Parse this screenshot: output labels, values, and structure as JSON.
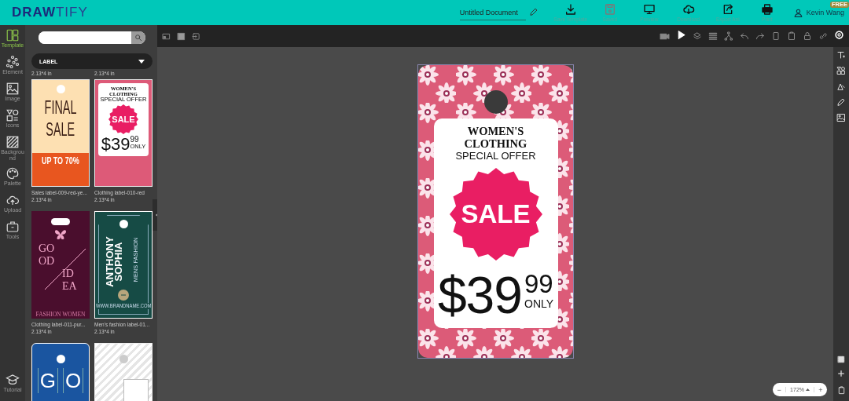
{
  "header": {
    "logo": [
      "DRAW",
      "TIFY"
    ],
    "document_title": "Untitled Document",
    "actions": [
      {
        "label": "Save Template",
        "kind": "download"
      },
      {
        "label": "Saved",
        "kind": "save"
      },
      {
        "label": "Preview",
        "kind": "preview"
      },
      {
        "label": "Download",
        "kind": "cloud"
      },
      {
        "label": "Export Ani",
        "kind": "export"
      },
      {
        "label": "Print",
        "kind": "print"
      }
    ],
    "user": {
      "name": "Kevin Wang",
      "badge": "FREE"
    }
  },
  "sidebar": {
    "items": [
      {
        "label": "Template",
        "kind": "template",
        "selected": true
      },
      {
        "label": "Element",
        "kind": "element",
        "selected": false
      },
      {
        "label": "Image",
        "kind": "image",
        "selected": false
      },
      {
        "label": "Icons",
        "kind": "icons",
        "selected": false
      },
      {
        "label": "Background",
        "kind": "background",
        "selected": false
      },
      {
        "label": "Palette",
        "kind": "palette",
        "selected": false
      },
      {
        "label": "Upload",
        "kind": "upload",
        "selected": false
      },
      {
        "label": "Tools",
        "kind": "tools",
        "selected": false
      }
    ],
    "footer": "Tutorial"
  },
  "template_panel": {
    "category": "LABEL",
    "sizes_above": [
      "2.13*4 in",
      "2.13*4 in"
    ],
    "templates": [
      {
        "kind": "final-sale",
        "name": "Sales label-009-red-ye...",
        "size": "2.13*4 in",
        "texts": [
          "FINAL",
          "SALE",
          "UP TO 70%"
        ]
      },
      {
        "kind": "clothing-sale",
        "name": "Clothing label-010-red",
        "size": "2.13*4 in",
        "texts": [
          "WOMEN'S",
          "CLOTHING",
          "SPECIAL OFFER",
          "SALE",
          "$39",
          "99",
          "ONLY"
        ]
      },
      {
        "kind": "good-idea",
        "name": "Clothing label-011-pur...",
        "size": "2.13*4 in",
        "texts": [
          "GO",
          "OD",
          "ID",
          "EA",
          "FASHION WOMEN"
        ]
      },
      {
        "kind": "anthony",
        "name": "Men's fashion label-01...",
        "size": "2.13*4 in",
        "texts": [
          "ANTHONY",
          "SOPHIA",
          "MENS FASHION",
          "WWW.BRANDNAME.COM"
        ]
      },
      {
        "kind": "blue-good",
        "texts": [
          "G",
          "O"
        ]
      },
      {
        "kind": "white-script"
      }
    ]
  },
  "canvas": {
    "zoom": "172%",
    "zoom_minus": "−",
    "zoom_plus": "+",
    "design": {
      "heading": [
        "WOMEN'S",
        "CLOTHING"
      ],
      "subheading": "SPECIAL OFFER",
      "badge": "SALE",
      "price": "$39",
      "cents": "99",
      "note": "ONLY"
    }
  }
}
